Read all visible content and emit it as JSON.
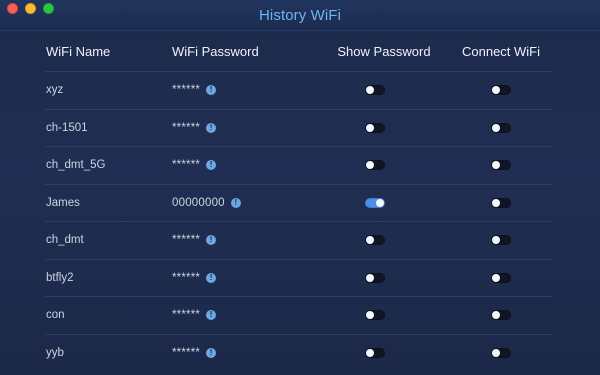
{
  "window": {
    "title": "History WiFi"
  },
  "headers": {
    "name": "WiFi Name",
    "password": "WiFi Password",
    "show": "Show Password",
    "connect": "Connect WiFi"
  },
  "info_glyph": "!",
  "rows": [
    {
      "name": "xyz",
      "password": "******",
      "show_on": false,
      "connect_on": false
    },
    {
      "name": "ch-1501",
      "password": "******",
      "show_on": false,
      "connect_on": false
    },
    {
      "name": "ch_dmt_5G",
      "password": "******",
      "show_on": false,
      "connect_on": false
    },
    {
      "name": "James",
      "password": "00000000",
      "show_on": true,
      "connect_on": false
    },
    {
      "name": "ch_dmt",
      "password": "******",
      "show_on": false,
      "connect_on": false
    },
    {
      "name": "btfly2",
      "password": "******",
      "show_on": false,
      "connect_on": false
    },
    {
      "name": "con",
      "password": "******",
      "show_on": false,
      "connect_on": false
    },
    {
      "name": "yyb",
      "password": "******",
      "show_on": false,
      "connect_on": false
    }
  ],
  "colors": {
    "title": "#6fb2f5",
    "toggle_on": "#4e8fe3",
    "info_icon": "#6ea7e6"
  }
}
